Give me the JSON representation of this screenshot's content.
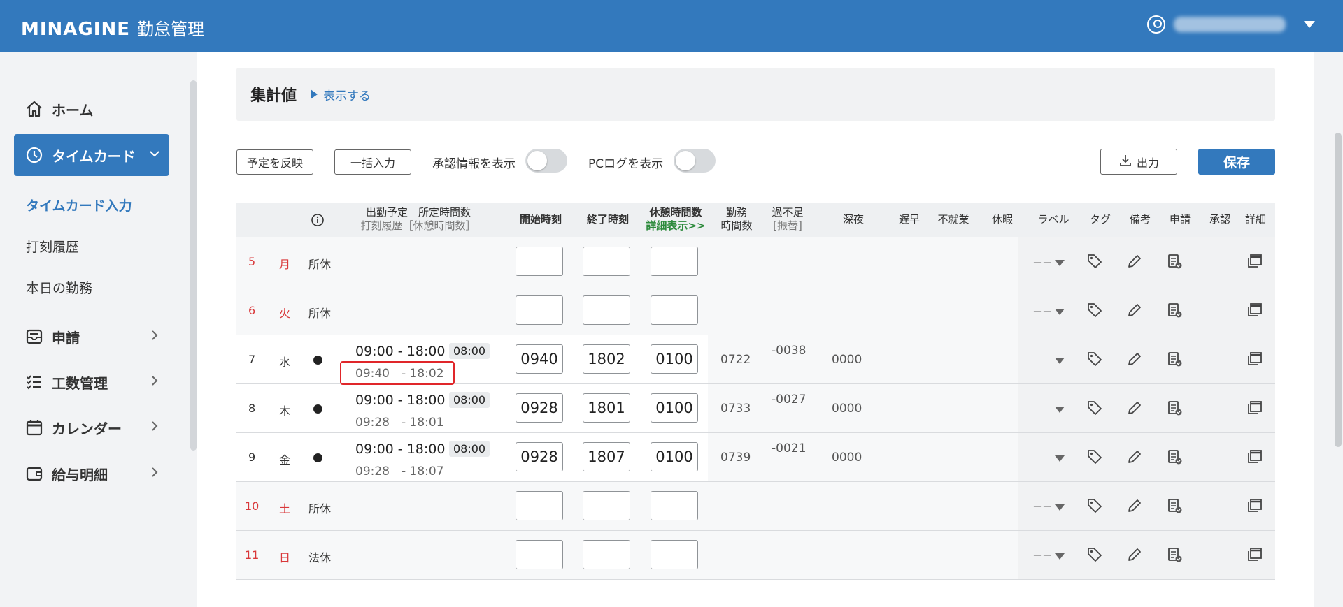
{
  "header": {
    "logo_main": "MINAGINE",
    "logo_sub": "勤怠管理"
  },
  "sidebar": {
    "items": [
      {
        "label": "ホーム",
        "icon": "home-icon"
      },
      {
        "label": "タイムカード",
        "icon": "clock-icon",
        "active": true
      },
      {
        "label": "申請",
        "icon": "inbox-icon"
      },
      {
        "label": "工数管理",
        "icon": "checklist-icon"
      },
      {
        "label": "カレンダー",
        "icon": "calendar-icon"
      },
      {
        "label": "給与明細",
        "icon": "wallet-icon"
      }
    ],
    "sub_items": [
      {
        "label": "タイムカード入力",
        "active": true
      },
      {
        "label": "打刻履歴"
      },
      {
        "label": "本日の勤務"
      }
    ]
  },
  "summary": {
    "title": "集計値",
    "toggle_label": "表示する"
  },
  "toolbar": {
    "apply_schedule": "予定を反映",
    "bulk_input": "一括入力",
    "show_approval": "承認情報を表示",
    "show_pclog": "PCログを表示",
    "export": "出力",
    "save": "保存"
  },
  "table": {
    "headers": {
      "schedule_top": "出勤予定　所定時間数",
      "schedule_bottom": "打刻履歴［休憩時間数］",
      "start": "開始時刻",
      "end": "終了時刻",
      "break_top": "休憩時間数",
      "break_bottom": "詳細表示>>",
      "work_top": "勤務",
      "work_bottom": "時間数",
      "over_top": "過不足",
      "over_bottom": "[振替]",
      "night": "深夜",
      "late": "遅早",
      "absence": "不就業",
      "leave": "休暇",
      "label": "ラベル",
      "tag": "タグ",
      "note": "備考",
      "request": "申請",
      "approval": "承認",
      "detail": "詳細"
    },
    "rows": [
      {
        "day": "5",
        "weekday": "月",
        "type": "所休",
        "start": "",
        "end": "",
        "break": ""
      },
      {
        "day": "6",
        "weekday": "火",
        "type": "所休",
        "start": "",
        "end": "",
        "break": ""
      },
      {
        "day": "7",
        "weekday": "水",
        "schedule": "09:00 - 18:00",
        "hours": "08:00",
        "actual": "09:40　- 18:02",
        "start": "0940",
        "end": "1802",
        "break": "0100",
        "work": "0722",
        "over": "-0038",
        "night": "0000"
      },
      {
        "day": "8",
        "weekday": "木",
        "schedule": "09:00 - 18:00",
        "hours": "08:00",
        "actual": "09:28　- 18:01",
        "start": "0928",
        "end": "1801",
        "break": "0100",
        "work": "0733",
        "over": "-0027",
        "night": "0000"
      },
      {
        "day": "9",
        "weekday": "金",
        "schedule": "09:00 - 18:00",
        "hours": "08:00",
        "actual": "09:28　- 18:07",
        "start": "0928",
        "end": "1807",
        "break": "0100",
        "work": "0739",
        "over": "-0021",
        "night": "0000"
      },
      {
        "day": "10",
        "weekday": "土",
        "type": "所休",
        "start": "",
        "end": "",
        "break": ""
      },
      {
        "day": "11",
        "weekday": "日",
        "type": "法休",
        "start": "",
        "end": "",
        "break": ""
      }
    ],
    "label_placeholder": "－－"
  }
}
